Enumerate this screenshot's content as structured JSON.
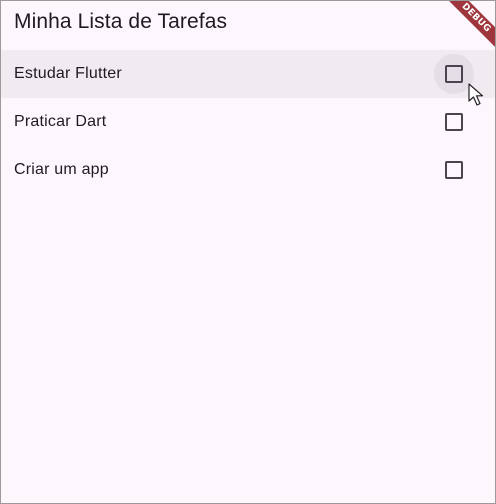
{
  "app_bar": {
    "title": "Minha Lista de Tarefas"
  },
  "debug_banner": {
    "label": "DEBUG",
    "color": "#a0363d"
  },
  "tasks": [
    {
      "label": "Estudar Flutter",
      "checked": false,
      "hovered": true
    },
    {
      "label": "Praticar Dart",
      "checked": false,
      "hovered": false
    },
    {
      "label": "Criar um app",
      "checked": false,
      "hovered": false
    }
  ],
  "colors": {
    "background": "#fdf7fd",
    "hover_row": "#f1eaf1",
    "text": "#1d1b20",
    "checkbox_border": "#49454f"
  },
  "icons": {
    "cursor": "mouse-pointer-icon"
  }
}
